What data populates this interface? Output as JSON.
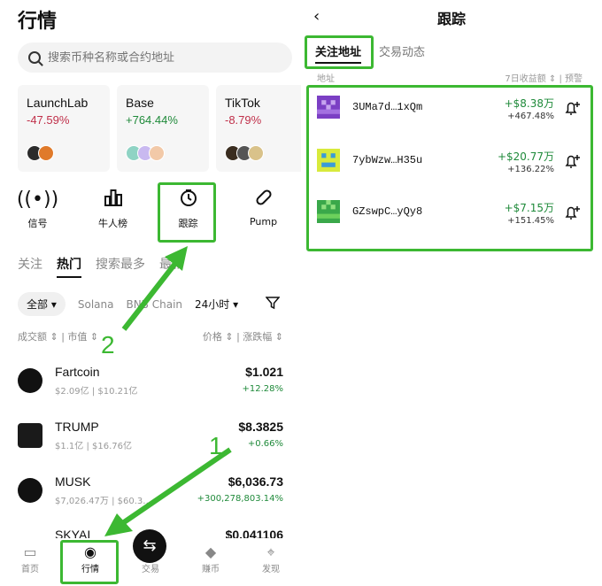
{
  "left": {
    "title": "行情",
    "search": {
      "placeholder": "搜索币种名称或合约地址"
    },
    "cards": [
      {
        "name": "LaunchLab",
        "change": "-47.59%"
      },
      {
        "name": "Base",
        "change": "+764.44%"
      },
      {
        "name": "TikTok",
        "change": "-8.79%"
      }
    ],
    "quick": [
      {
        "label": "信号",
        "icon": "signal-icon"
      },
      {
        "label": "牛人榜",
        "icon": "ranking-icon"
      },
      {
        "label": "跟踪",
        "icon": "track-icon"
      },
      {
        "label": "Pump",
        "icon": "pill-icon"
      }
    ],
    "subtabs": [
      "关注",
      "热门",
      "搜索最多",
      "最新"
    ],
    "filters": {
      "all": "全部",
      "chain1": "Solana",
      "chain2": "BNB Chain",
      "period": "24小时"
    },
    "columns": {
      "volume": "成交额",
      "mcap": "市值",
      "price": "价格",
      "change": "涨跌幅"
    },
    "rows": [
      {
        "name": "Fartcoin",
        "sub": "$2.09亿 | $10.21亿",
        "price": "$1.021",
        "change": "+12.28%"
      },
      {
        "name": "TRUMP",
        "sub": "$1.1亿 | $16.76亿",
        "price": "$8.3825",
        "change": "+0.66%"
      },
      {
        "name": "MUSK",
        "sub": "$7,026.47万 | $60.3…",
        "price": "$6,036.73",
        "change": "+300,278,803.14%"
      },
      {
        "name": "SKYAI",
        "sub": "",
        "price": "$0.041106",
        "change": ""
      }
    ],
    "bottom": [
      {
        "label": "首页",
        "icon": "home-icon"
      },
      {
        "label": "行情",
        "icon": "market-icon"
      },
      {
        "label": "交易",
        "icon": "trade-icon"
      },
      {
        "label": "赚币",
        "icon": "earn-icon"
      },
      {
        "label": "发现",
        "icon": "discover-icon"
      }
    ],
    "step1": "1",
    "step2": "2"
  },
  "right": {
    "title": "跟踪",
    "tabs": [
      "关注地址",
      "交易动态"
    ],
    "header": {
      "address": "地址",
      "yield": "7日收益额 ⇕ | 预警"
    },
    "addresses": [
      {
        "addr": "3UMa7d…1xQm",
        "amount": "+$8.38万",
        "pct": "+467.48%"
      },
      {
        "addr": "7ybWzw…H35u",
        "amount": "+$20.77万",
        "pct": "+136.22%"
      },
      {
        "addr": "GZswpC…yQy8",
        "amount": "+$7.15万",
        "pct": "+151.45%"
      }
    ]
  },
  "colors": {
    "highlight": "#3cb832",
    "positive": "#1f8a3a",
    "negative": "#c0304a"
  }
}
